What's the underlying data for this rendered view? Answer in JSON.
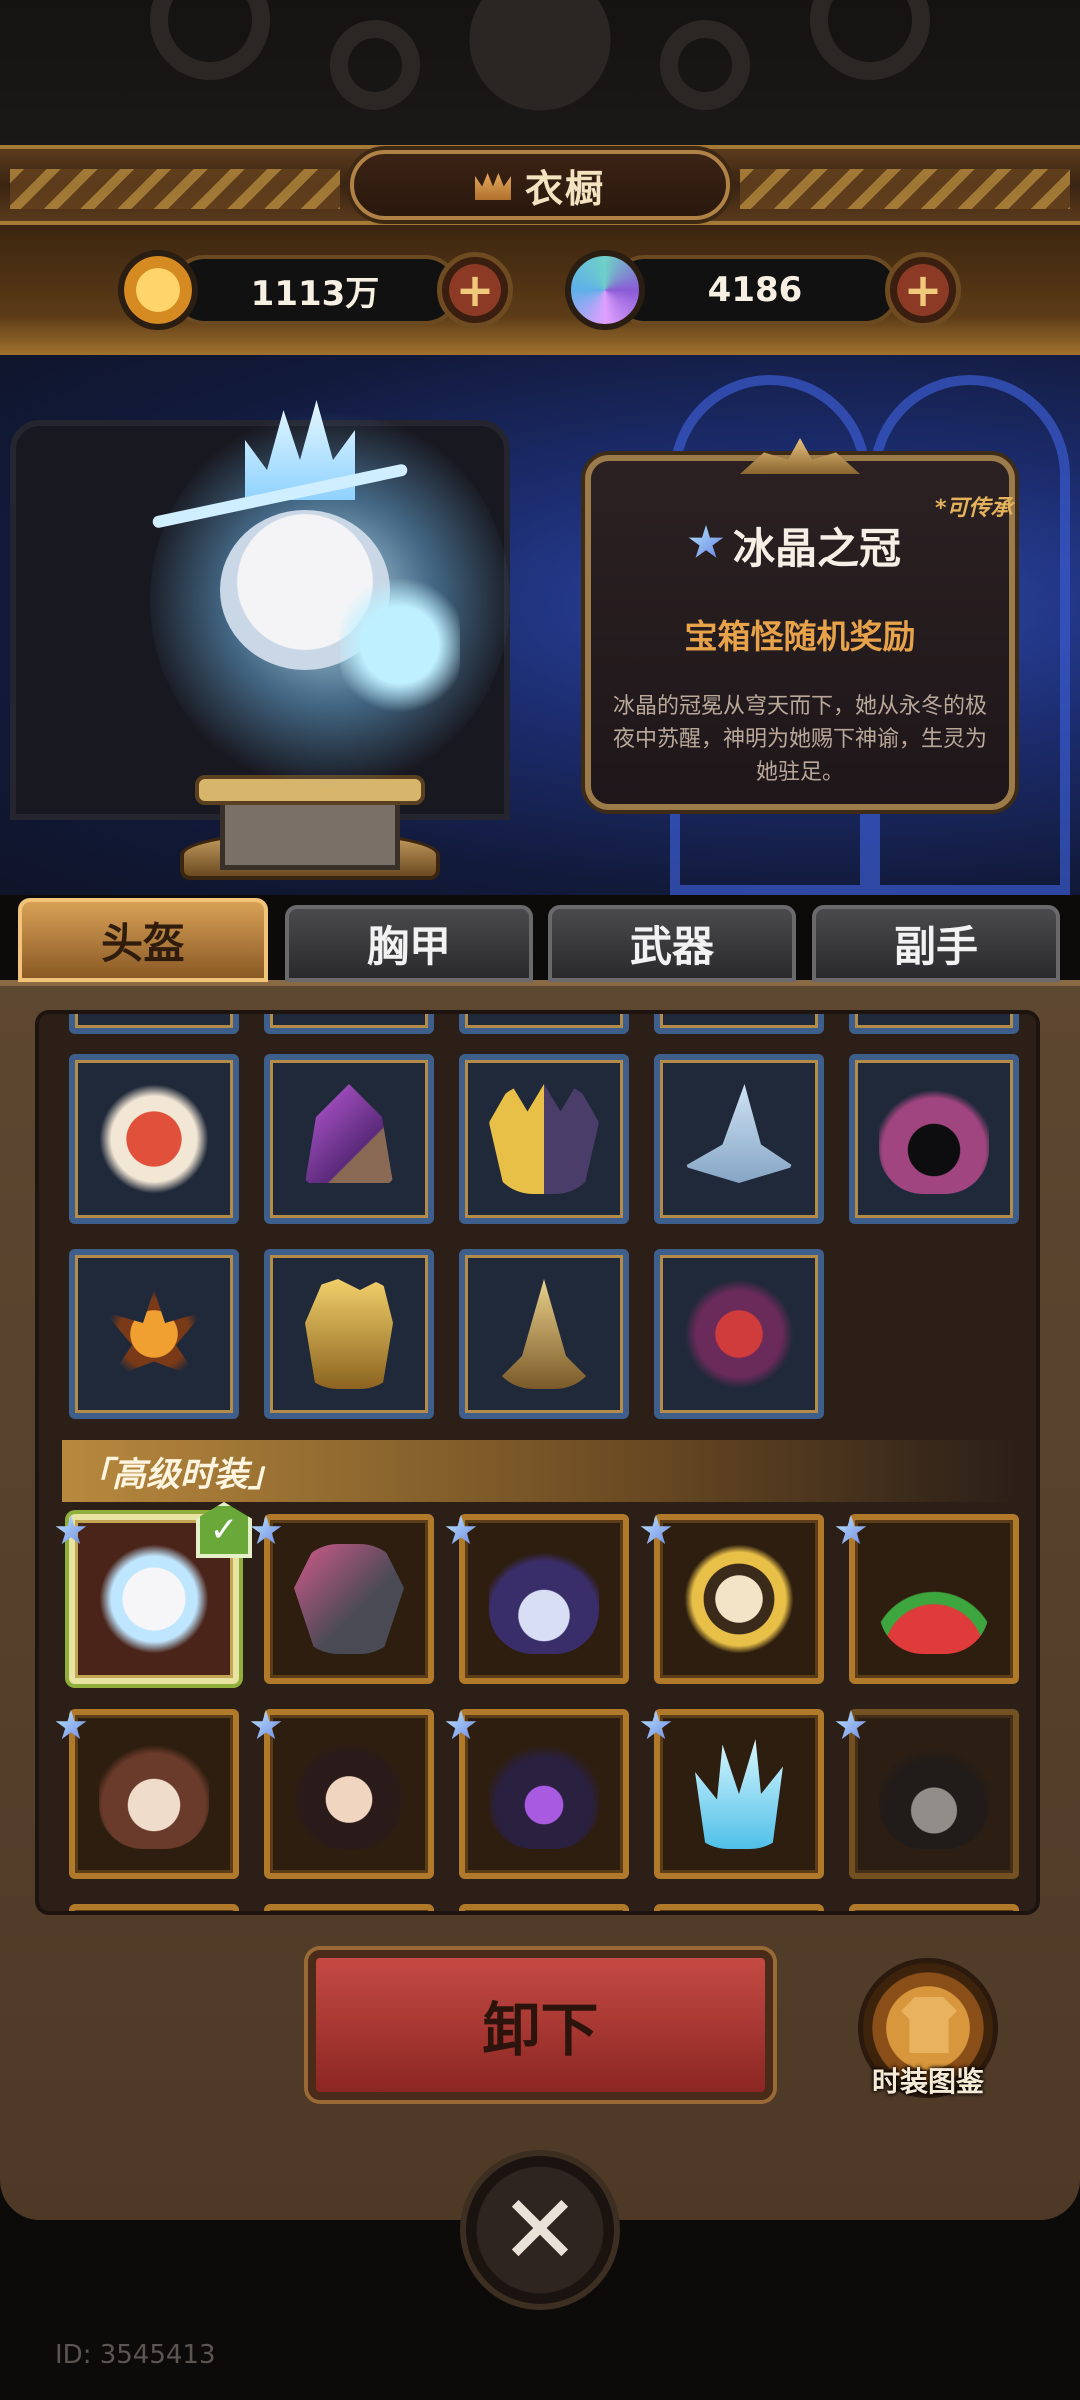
{
  "header": {
    "title": "衣橱",
    "title_icon": "wardrobe-crown-icon"
  },
  "currency": {
    "gold": {
      "icon": "gold-coin-icon",
      "value": "1113万",
      "color": "#e8a93a"
    },
    "gems": {
      "icon": "gem-icon",
      "value": "4186",
      "color": "#6fd0c8"
    }
  },
  "item_card": {
    "inheritable": "*可传承",
    "name": "冰晶之冠",
    "source": "宝箱怪随机奖励",
    "description": "冰晶的冠冕从穹天而下，她从永冬的极夜中苏醒，神明为她赐下神谕，生灵为她驻足。"
  },
  "tabs": [
    {
      "label": "头盔",
      "active": true
    },
    {
      "label": "胸甲",
      "active": false
    },
    {
      "label": "武器",
      "active": false
    },
    {
      "label": "副手",
      "active": false
    }
  ],
  "basic_items": [
    {
      "icon": "red-oni-mask-icon"
    },
    {
      "icon": "purple-crystal-helm-icon"
    },
    {
      "icon": "gold-crown-mask-icon"
    },
    {
      "icon": "wizard-hat-icon"
    },
    {
      "icon": "purple-hood-icon"
    },
    {
      "icon": "spiked-crown-icon"
    },
    {
      "icon": "golden-dragon-helm-icon"
    },
    {
      "icon": "spiral-gold-helm-icon"
    },
    {
      "icon": "dark-feather-mask-icon"
    }
  ],
  "advanced_section": {
    "label": "「高级时装」"
  },
  "advanced_items": [
    {
      "icon": "ice-crown-hero-icon",
      "selected": true,
      "equipped": true
    },
    {
      "icon": "mecha-helmet-icon"
    },
    {
      "icon": "witch-hat-hero-icon"
    },
    {
      "icon": "sun-crown-hero-icon"
    },
    {
      "icon": "watermelon-crown-icon"
    },
    {
      "icon": "mushroom-hat-hero-icon"
    },
    {
      "icon": "dark-hair-hero-icon"
    },
    {
      "icon": "purple-witch-hat-icon"
    },
    {
      "icon": "ice-shard-hair-icon"
    },
    {
      "icon": "top-hat-penguin-icon",
      "dimmed": true
    }
  ],
  "actions": {
    "unequip_label": "卸下",
    "codex_label": "时装图鉴"
  },
  "footer": {
    "player_id": "ID: 3545413"
  }
}
